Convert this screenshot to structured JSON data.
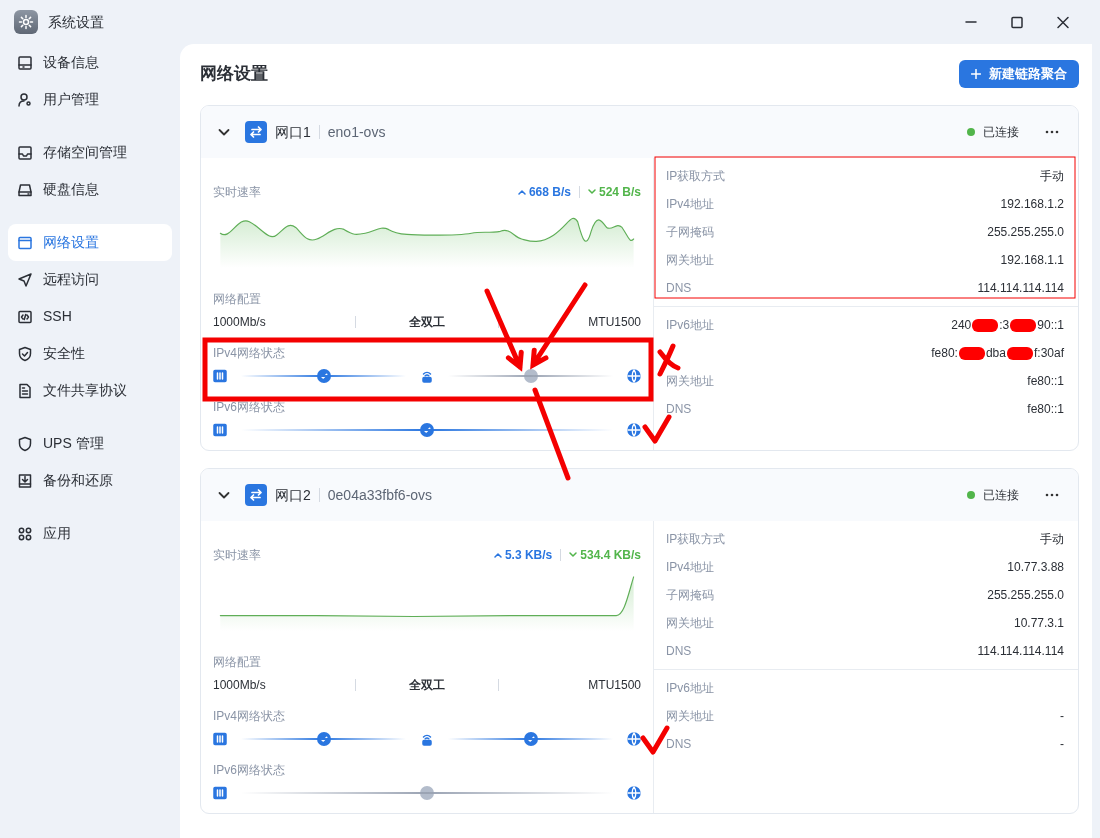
{
  "window": {
    "title": "系统设置"
  },
  "sidebar": {
    "sections": [
      {
        "items": [
          {
            "label": "设备信息",
            "selected": false
          },
          {
            "label": "用户管理",
            "selected": false
          }
        ]
      },
      {
        "items": [
          {
            "label": "存储空间管理",
            "selected": false
          },
          {
            "label": "硬盘信息",
            "selected": false
          }
        ]
      },
      {
        "items": [
          {
            "label": "网络设置",
            "selected": true
          },
          {
            "label": "远程访问",
            "selected": false
          },
          {
            "label": "SSH",
            "selected": false
          },
          {
            "label": "安全性",
            "selected": false
          },
          {
            "label": "文件共享协议",
            "selected": false
          }
        ]
      },
      {
        "items": [
          {
            "label": "UPS 管理",
            "selected": false
          },
          {
            "label": "备份和还原",
            "selected": false
          }
        ]
      },
      {
        "items": [
          {
            "label": "应用",
            "selected": false
          }
        ]
      }
    ]
  },
  "page": {
    "title": "网络设置",
    "action_button": {
      "label": "新建链路聚合"
    }
  },
  "ports": [
    {
      "name": "网口1",
      "device": "eno1-ovs",
      "expanded": true,
      "status": {
        "label": "已连接",
        "color": "#52b54b"
      },
      "speed": {
        "label": "实时速率",
        "upload": "668 B/s",
        "download": "524 B/s"
      },
      "config": {
        "label": "网络配置",
        "values": [
          "1000Mb/s",
          "全双工",
          "MTU1500"
        ]
      },
      "ipv4_status": {
        "label": "IPv4网络状态",
        "stages": [
          {
            "done": true
          },
          {
            "done": false
          }
        ]
      },
      "ipv6_status": {
        "label": "IPv6网络状态",
        "stages": [
          {
            "done": true
          }
        ]
      },
      "ipv4_info": [
        {
          "label": "IP获取方式",
          "value": "手动"
        },
        {
          "label": "IPv4地址",
          "value": "192.168.1.2"
        },
        {
          "label": "子网掩码",
          "value": "255.255.255.0"
        },
        {
          "label": "网关地址",
          "value": "192.168.1.1"
        },
        {
          "label": "DNS",
          "value": "114.114.114.114"
        }
      ],
      "ipv6_info": [
        {
          "label": "IPv6地址",
          "redacted": true,
          "value_parts": [
            "240",
            ":3",
            "90::1"
          ]
        },
        {
          "redacted": true,
          "value_parts": [
            "fe80:",
            "dba",
            "f:30af"
          ]
        },
        {
          "label": "网关地址",
          "value": "fe80::1"
        },
        {
          "label": "DNS",
          "value": "fe80::1"
        }
      ]
    },
    {
      "name": "网口2",
      "device": "0e04a33fbf6-ovs",
      "expanded": true,
      "status": {
        "label": "已连接",
        "color": "#52b54b"
      },
      "speed": {
        "label": "实时速率",
        "upload": "5.3 KB/s",
        "download": "534.4 KB/s"
      },
      "config": {
        "label": "网络配置",
        "values": [
          "1000Mb/s",
          "全双工",
          "MTU1500"
        ]
      },
      "ipv4_status": {
        "label": "IPv4网络状态",
        "stages": [
          {
            "done": true
          },
          {
            "done": true
          }
        ]
      },
      "ipv6_status": {
        "label": "IPv6网络状态",
        "stages": [
          {
            "done": false
          }
        ]
      },
      "ipv4_info": [
        {
          "label": "IP获取方式",
          "value": "手动"
        },
        {
          "label": "IPv4地址",
          "value": "10.77.3.88"
        },
        {
          "label": "子网掩码",
          "value": "255.255.255.0"
        },
        {
          "label": "网关地址",
          "value": "10.77.3.1"
        },
        {
          "label": "DNS",
          "value": "114.114.114.114"
        }
      ],
      "ipv6_info": [
        {
          "label": "IPv6地址"
        },
        {
          "label": "网关地址",
          "value": "-"
        },
        {
          "label": "DNS",
          "value": "-"
        }
      ]
    }
  ],
  "annotations": [
    {
      "kind": "frame"
    },
    {
      "kind": "outline"
    },
    {
      "kind": "arrow"
    },
    {
      "kind": "arrow"
    },
    {
      "kind": "line"
    },
    {
      "kind": "cross"
    },
    {
      "kind": "check"
    },
    {
      "kind": "check"
    }
  ]
}
